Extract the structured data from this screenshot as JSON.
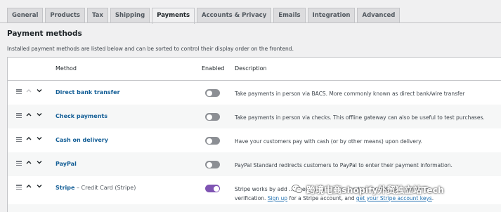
{
  "tabs": [
    {
      "label": "General",
      "active": false
    },
    {
      "label": "Products",
      "active": false
    },
    {
      "label": "Tax",
      "active": false
    },
    {
      "label": "Shipping",
      "active": false
    },
    {
      "label": "Payments",
      "active": true
    },
    {
      "label": "Accounts & Privacy",
      "active": false
    },
    {
      "label": "Emails",
      "active": false
    },
    {
      "label": "Integration",
      "active": false
    },
    {
      "label": "Advanced",
      "active": false
    }
  ],
  "page": {
    "title": "Payment methods",
    "description": "Installed payment methods are listed below and can be sorted to control their display order on the frontend."
  },
  "table": {
    "headers": {
      "method": "Method",
      "enabled": "Enabled",
      "description": "Description"
    },
    "rows": [
      {
        "name": "Direct bank transfer",
        "subname": "",
        "enabled": false,
        "description": "Take payments in person via BACS. More commonly known as direct bank/wire transfer"
      },
      {
        "name": "Check payments",
        "subname": "",
        "enabled": false,
        "description": "Take payments in person via checks. This offline gateway can also be useful to test purchases."
      },
      {
        "name": "Cash on delivery",
        "subname": "",
        "enabled": false,
        "description": "Have your customers pay with cash (or by other means) upon delivery."
      },
      {
        "name": "PayPal",
        "subname": "",
        "enabled": false,
        "description": "PayPal Standard redirects customers to PayPal to enter their payment information."
      },
      {
        "name": "Stripe",
        "subname": " – Credit Card (Stripe)",
        "enabled": true,
        "description_pre": "Stripe works by add",
        "description_mid": "checkout and then sending the details to Stripe for",
        "description_line2_pre": "verification. ",
        "sign_up_link": "Sign up",
        "description_line2_mid": " for a Stripe account, and ",
        "api_keys_link": "get your Stripe account keys",
        "description_line2_end": "."
      }
    ]
  },
  "watermark": {
    "text": "跨境电商shopify外贸独立站Tech",
    "icon": "wechat-icon"
  },
  "colors": {
    "link": "#135e96",
    "toggle_on": "#7f54b3",
    "toggle_off": "#8c8f94"
  }
}
